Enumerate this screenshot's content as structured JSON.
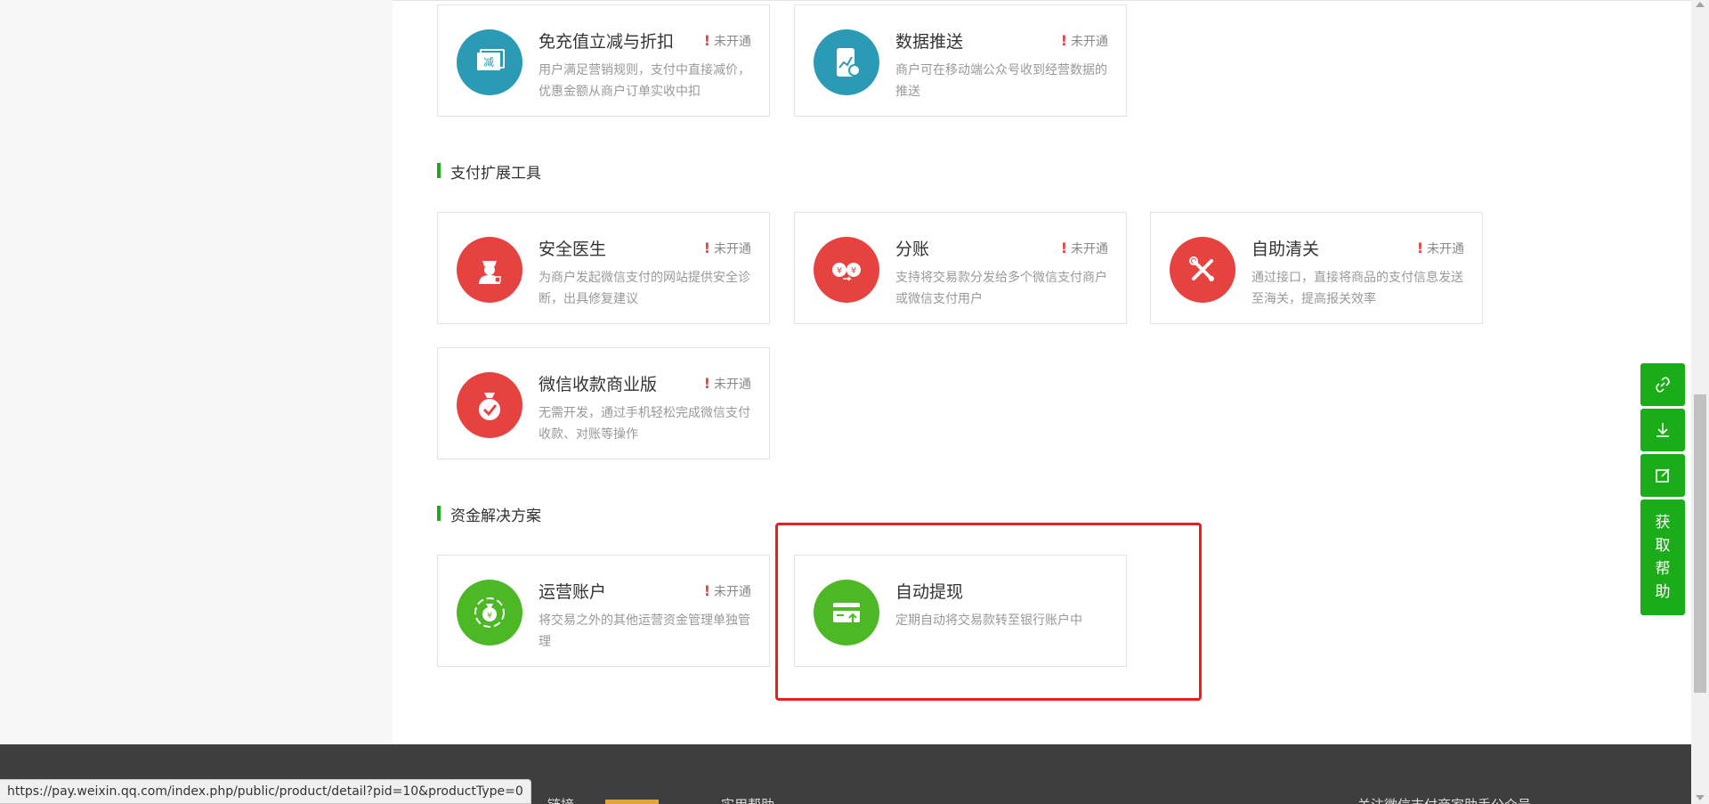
{
  "sections": {
    "payment_tools_title": "支付扩展工具",
    "funds_title": "资金解决方案"
  },
  "status_label": "未开通",
  "cards": {
    "discount": {
      "title": "免充值立减与折扣",
      "desc": "用户满足营销规则，支付中直接减价，优惠金额从商户订单实收中扣",
      "status": "未开通",
      "icon": "ticket-icon",
      "color": "#2b9bb5"
    },
    "data_push": {
      "title": "数据推送",
      "desc": "商户可在移动端公众号收到经营数据的推送",
      "status": "未开通",
      "icon": "phone-chart-icon",
      "color": "#2b9bb5"
    },
    "security_doctor": {
      "title": "安全医生",
      "desc": "为商户发起微信支付的网站提供安全诊断，出具修复建议",
      "status": "未开通",
      "icon": "doctor-icon",
      "color": "#e64340"
    },
    "split_account": {
      "title": "分账",
      "desc": "支持将交易款分发给多个微信支付商户或微信支付用户",
      "status": "未开通",
      "icon": "yen-transfer-icon",
      "color": "#e64340"
    },
    "customs": {
      "title": "自助清关",
      "desc": "通过接口，直接将商品的支付信息发送至海关，提高报关效率",
      "status": "未开通",
      "icon": "tools-icon",
      "color": "#e64340"
    },
    "wechat_pro": {
      "title": "微信收款商业版",
      "desc": "无需开发，通过手机轻松完成微信支付收款、对账等操作",
      "status": "未开通",
      "icon": "money-bag-check-icon",
      "color": "#e64340"
    },
    "operating_account": {
      "title": "运营账户",
      "desc": "将交易之外的其他运营资金管理单独管理",
      "status": "未开通",
      "icon": "money-bag-cycle-icon",
      "color": "#4cb826"
    },
    "auto_withdraw": {
      "title": "自动提现",
      "desc": "定期自动将交易款转至银行账户中",
      "icon": "card-upload-icon",
      "color": "#4cb826"
    }
  },
  "side_tools": {
    "help_label_1": "获",
    "help_label_2": "取",
    "help_label_3": "帮",
    "help_label_4": "助"
  },
  "footer": {
    "col1": "链接",
    "col2": "实用帮助",
    "col3": "关注微信支付商家助手公众号"
  },
  "status_bar_url": "https://pay.weixin.qq.com/index.php/public/product/detail?pid=10&productType=0"
}
